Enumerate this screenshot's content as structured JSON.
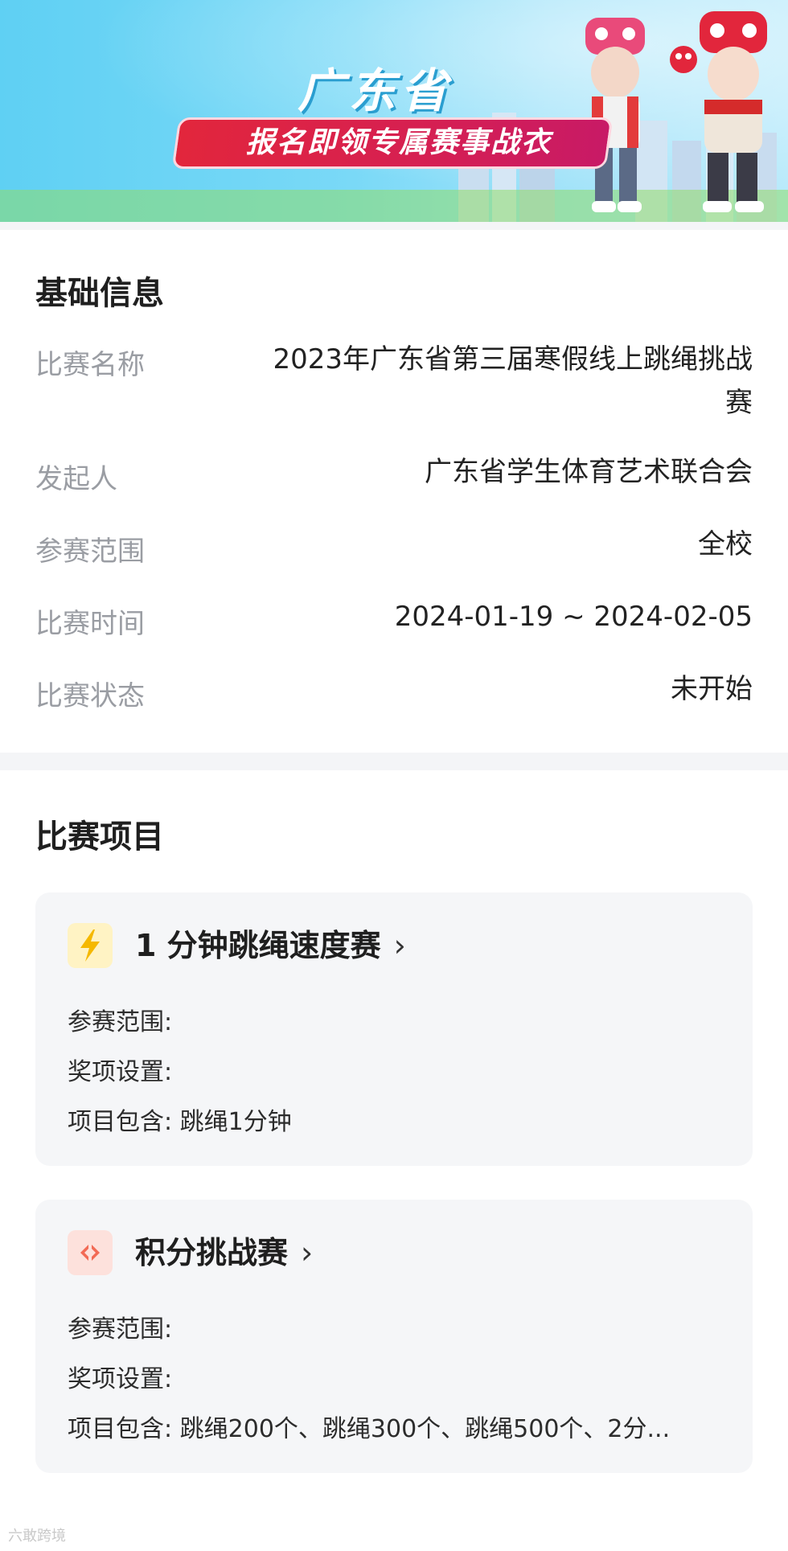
{
  "banner": {
    "title": "广东省",
    "ribbon": "报名即领专属赛事战衣"
  },
  "basic_info": {
    "title": "基础信息",
    "rows": [
      {
        "label": "比赛名称",
        "value_line1": "2023年广东省第三届寒假线上跳绳挑战",
        "value_line2": "赛"
      },
      {
        "label": "发起人",
        "value": "广东省学生体育艺术联合会"
      },
      {
        "label": "参赛范围",
        "value": "全校"
      },
      {
        "label": "比赛时间",
        "value": "2024-01-19 ~ 2024-02-05"
      },
      {
        "label": "比赛状态",
        "value": "未开始"
      }
    ]
  },
  "events": {
    "title": "比赛项目",
    "items": [
      {
        "name": "1 分钟跳绳速度赛",
        "chevron": "›",
        "icon": "lightning-icon",
        "icon_color": "#f5b800",
        "scope": "参赛范围:",
        "awards": "奖项设置:",
        "includes": "项目包含: 跳绳1分钟"
      },
      {
        "name": "积分挑战赛",
        "chevron": "›",
        "icon": "code-diamond-icon",
        "icon_color": "#f26a55",
        "scope": "参赛范围:",
        "awards": "奖项设置:",
        "includes": "项目包含: 跳绳200个、跳绳300个、跳绳500个、2分..."
      }
    ]
  },
  "watermark": "六敢跨境"
}
